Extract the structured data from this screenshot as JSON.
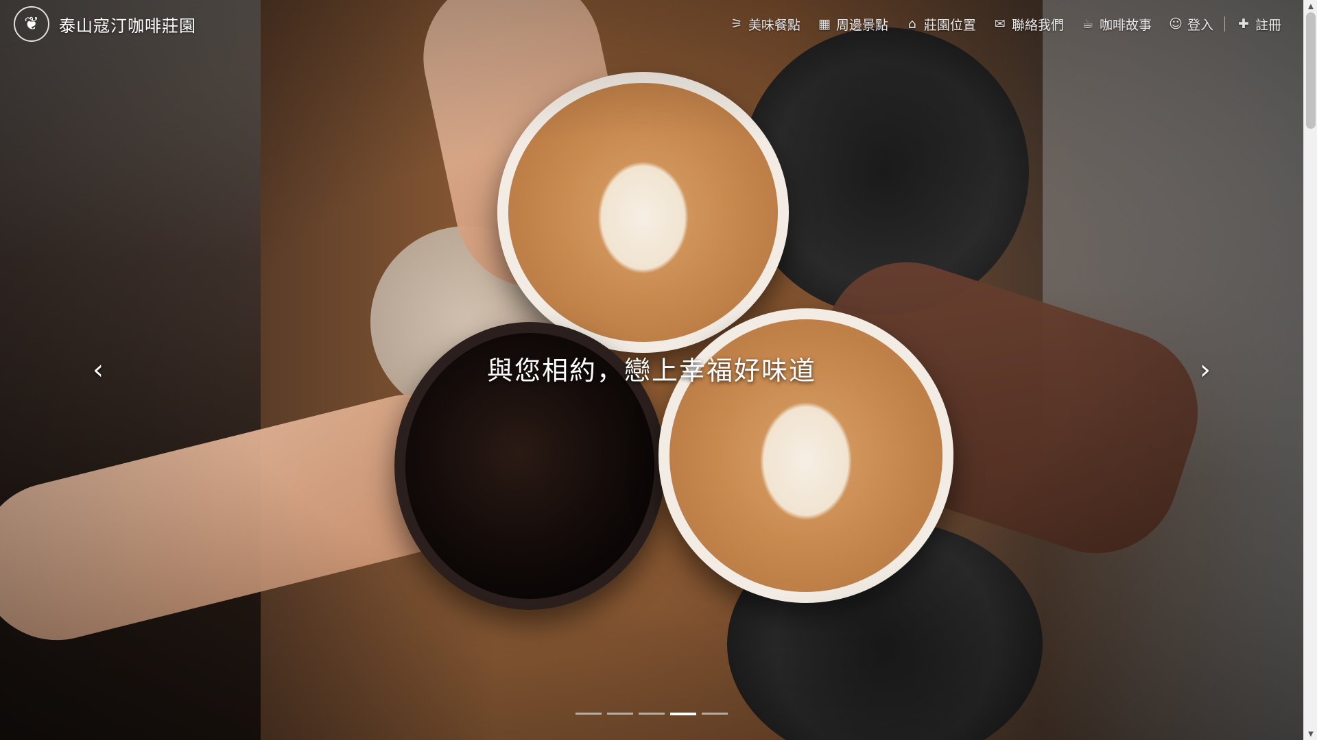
{
  "brand": {
    "title": "泰山寇汀咖啡莊園",
    "logo_icon": "laurel-crest-icon"
  },
  "nav": {
    "items": [
      {
        "label": "美味餐點",
        "icon": "fish-icon",
        "glyph": "⚞"
      },
      {
        "label": "周邊景點",
        "icon": "map-icon",
        "glyph": "🗺"
      },
      {
        "label": "莊園位置",
        "icon": "building-icon",
        "glyph": "⌂"
      },
      {
        "label": "聯絡我們",
        "icon": "envelope-icon",
        "glyph": "✉"
      },
      {
        "label": "咖啡故事",
        "icon": "coffee-cup-icon",
        "glyph": "☕"
      },
      {
        "label": "登入",
        "icon": "smile-icon",
        "glyph": "☺"
      },
      {
        "label": "註冊",
        "icon": "plus-icon",
        "glyph": "✚"
      }
    ]
  },
  "hero": {
    "caption": "與您相約，戀上幸福好味道",
    "prev_glyph": "‹",
    "next_glyph": "›",
    "slide_count": 5,
    "active_slide": 4
  },
  "colors": {
    "nav_text": "#e9e9e9",
    "caption_text": "#ffffff",
    "indicator_active": "#ffffff"
  }
}
